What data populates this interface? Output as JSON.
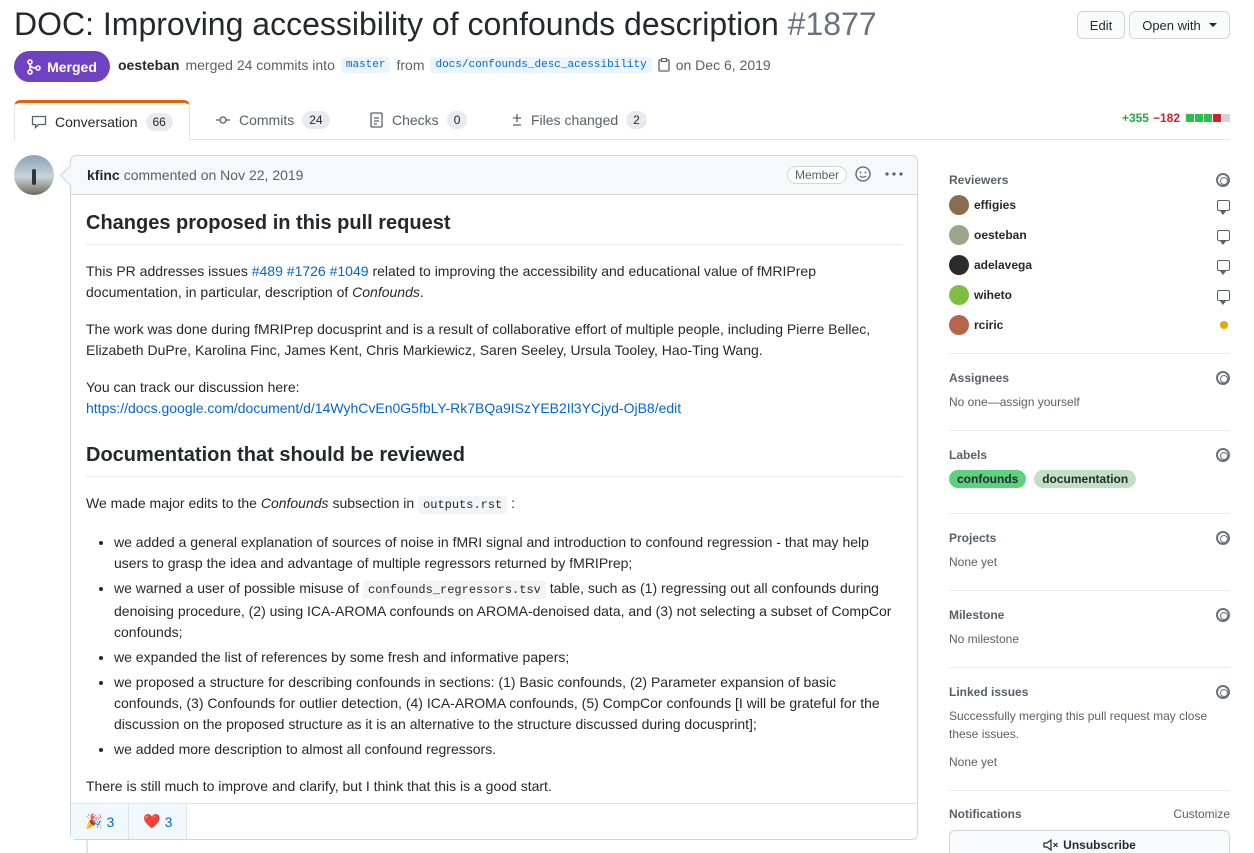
{
  "header": {
    "title": "DOC: Improving accessibility of confounds description",
    "number": "#1877",
    "edit_label": "Edit",
    "open_with_label": "Open with"
  },
  "state": {
    "label": "Merged",
    "color": "#6f42c1"
  },
  "meta": {
    "author": "oesteban",
    "action": "merged 24 commits into",
    "base_branch": "master",
    "from_word": "from",
    "head_branch": "docs/confounds_desc_acessibility",
    "date": "on Dec 6, 2019"
  },
  "tabs": [
    {
      "label": "Conversation",
      "count": "66",
      "icon": "comment-icon"
    },
    {
      "label": "Commits",
      "count": "24",
      "icon": "commit-icon"
    },
    {
      "label": "Checks",
      "count": "0",
      "icon": "checklist-icon"
    },
    {
      "label": "Files changed",
      "count": "2",
      "icon": "diff-icon"
    }
  ],
  "diffstat": {
    "additions": "+355",
    "deletions": "−182"
  },
  "comment": {
    "author": "kfinc",
    "action": "commented on Nov 22, 2019",
    "role": "Member",
    "h1": "Changes proposed in this pull request",
    "p1_pre": "This PR addresses issues",
    "issue1": "#489",
    "issue2": "#1726",
    "issue3": "#1049",
    "p1_post": "related to improving the accessibility and educational value of fMRIPrep documentation, in particular, description of",
    "p1_em": "Confounds",
    "p1_end": ".",
    "p2": "The work was done during fMRIPrep docusprint and is a result of collaborative effort of multiple people, including Pierre Bellec, Elizabeth DuPre, Karolina Finc, James Kent, Chris Markiewicz, Saren Seeley, Ursula Tooley, Hao-Ting Wang.",
    "p3": "You can track our discussion here:",
    "p3_link": "https://docs.google.com/document/d/14WyhCvEn0G5fbLY-Rk7BQa9ISzYEB2Il3YCjyd-OjB8/edit",
    "h2": "Documentation that should be reviewed",
    "p4_pre": "We made major edits to the",
    "p4_em": "Confounds",
    "p4_mid": "subsection in",
    "p4_code": "outputs.rst",
    "p4_end": ":",
    "li1": "we added a general explanation of sources of noise in fMRI signal and introduction to confound regression - that may help users to grasp the idea and advantage of multiple regressors returned by fMRIPrep;",
    "li2_pre": "we warned a user of possible misuse of",
    "li2_code": "confounds_regressors.tsv",
    "li2_post": "table, such as (1) regressing out all confounds during denoising procedure, (2) using ICA-AROMA confounds on AROMA-denoised data, and (3) not selecting a subset of CompCor confounds;",
    "li3": "we expanded the list of references by some fresh and informative papers;",
    "li4": "we proposed a structure for describing confounds in sections: (1) Basic confounds, (2) Parameter expansion of basic confounds, (3) Confounds for outlier detection, (4) ICA-AROMA confounds, (5) CompCor confounds [I will be grateful for the discussion on the proposed structure as it is an alternative to the structure discussed during docusprint];",
    "li5": "we added more description to almost all confound regressors.",
    "p5": "There is still much to improve and clarify, but I think that this is a good start.",
    "reactions": [
      {
        "emoji": "🎉",
        "count": "3",
        "icon": "tada-icon"
      },
      {
        "emoji": "❤️",
        "count": "3",
        "icon": "heart-icon"
      }
    ]
  },
  "sidebar": {
    "reviewers_title": "Reviewers",
    "reviewers": [
      {
        "name": "effigies",
        "status": "commented"
      },
      {
        "name": "oesteban",
        "status": "commented"
      },
      {
        "name": "adelavega",
        "status": "commented"
      },
      {
        "name": "wiheto",
        "status": "commented"
      },
      {
        "name": "rciric",
        "status": "pending"
      }
    ],
    "assignees_title": "Assignees",
    "assignees_text": "No one—assign yourself",
    "labels_title": "Labels",
    "labels": [
      {
        "name": "confounds",
        "color": "#5ed17f"
      },
      {
        "name": "documentation",
        "color": "#c2e0c6"
      }
    ],
    "projects_title": "Projects",
    "projects_text": "None yet",
    "milestone_title": "Milestone",
    "milestone_text": "No milestone",
    "linked_title": "Linked issues",
    "linked_desc": "Successfully merging this pull request may close these issues.",
    "linked_text": "None yet",
    "notifications_title": "Notifications",
    "customize_label": "Customize",
    "unsubscribe_label": "Unsubscribe"
  }
}
